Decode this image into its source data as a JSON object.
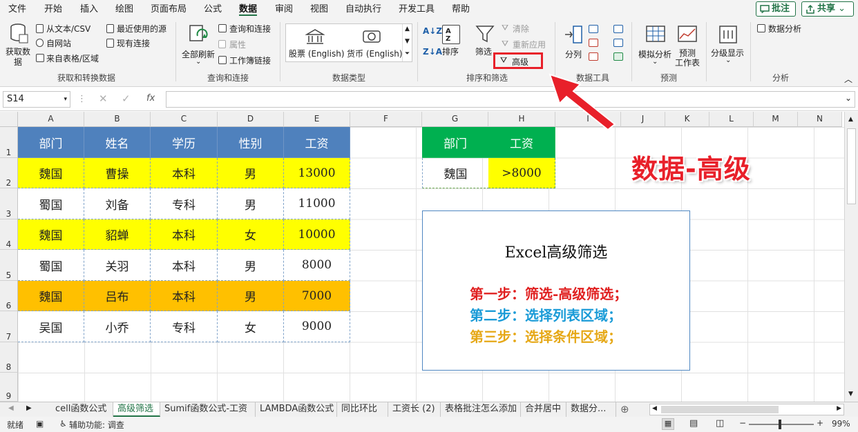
{
  "menu": {
    "items": [
      "文件",
      "开始",
      "插入",
      "绘图",
      "页面布局",
      "公式",
      "数据",
      "审阅",
      "视图",
      "自动执行",
      "开发工具",
      "帮助"
    ],
    "comments": "批注",
    "share": "共享"
  },
  "ribbon": {
    "get_data": "获取数\n据",
    "from_text": "从文本/CSV",
    "from_web": "自网站",
    "from_table": "来自表格/区域",
    "recent": "最近使用的源",
    "existing": "现有连接",
    "group_get": "获取和转换数据",
    "refresh_all": "全部刷新",
    "queries": "查询和连接",
    "properties": "属性",
    "workbook_links": "工作簿链接",
    "group_queries": "查询和连接",
    "stocks": "股票 (English)",
    "currency": "货币 (English)",
    "group_datatypes": "数据类型",
    "sort": "排序",
    "filter": "筛选",
    "clear": "清除",
    "reapply": "重新应用",
    "advanced": "高级",
    "group_sortfilter": "排序和筛选",
    "split": "分列",
    "group_datatools": "数据工具",
    "whatif": "模拟分析",
    "forecast": "预测\n工作表",
    "group_forecast": "预测",
    "outline": "分级显示",
    "analysis": "数据分析",
    "group_analysis": "分析"
  },
  "formula": {
    "namebox": "S14",
    "fx": "fx",
    "value": ""
  },
  "columns": [
    "A",
    "B",
    "C",
    "D",
    "E",
    "F",
    "G",
    "H",
    "I",
    "J",
    "K",
    "L",
    "M",
    "N"
  ],
  "rows": [
    "1",
    "2",
    "3",
    "4",
    "5",
    "6",
    "7",
    "8",
    "9"
  ],
  "table": {
    "headers": [
      "部门",
      "姓名",
      "学历",
      "性别",
      "工资"
    ],
    "rows": [
      [
        "魏国",
        "曹操",
        "本科",
        "男",
        "13000"
      ],
      [
        "蜀国",
        "刘备",
        "专科",
        "男",
        "11000"
      ],
      [
        "魏国",
        "貂蝉",
        "本科",
        "女",
        "10000"
      ],
      [
        "蜀国",
        "关羽",
        "本科",
        "男",
        "8000"
      ],
      [
        "魏国",
        "吕布",
        "本科",
        "男",
        "7000"
      ],
      [
        "吴国",
        "小乔",
        "专科",
        "女",
        "9000"
      ]
    ]
  },
  "criteria": {
    "headers": [
      "部门",
      "工资"
    ],
    "values": [
      "魏国",
      ">8000"
    ]
  },
  "annotation": "数据-高级",
  "textbox": {
    "title": "Excel高级筛选",
    "step1": "第一步：筛选-高级筛选；",
    "step2": "第二步：选择列表区域；",
    "step3": "第三步：选择条件区域；"
  },
  "sheets": [
    "cell函数公式",
    "高级筛选",
    "Sumif函数公式-工资",
    "LAMBDA函数公式",
    "同比环比",
    "工资长 (2)",
    "表格批注怎么添加",
    "合并居中",
    "数据分..."
  ],
  "active_sheet": "高级筛选",
  "status": {
    "ready": "就绪",
    "accessibility": "辅助功能: 调查",
    "zoom": "99%"
  },
  "colors": {
    "header_blue": "#4f81bd",
    "criteria_green": "#00b050",
    "highlight_yellow": "#ffff00",
    "highlight_orange": "#ffc000",
    "annotation_red": "#e8202a",
    "step1": "#e02020",
    "step2": "#1a9bd7",
    "step3": "#e6a817"
  }
}
